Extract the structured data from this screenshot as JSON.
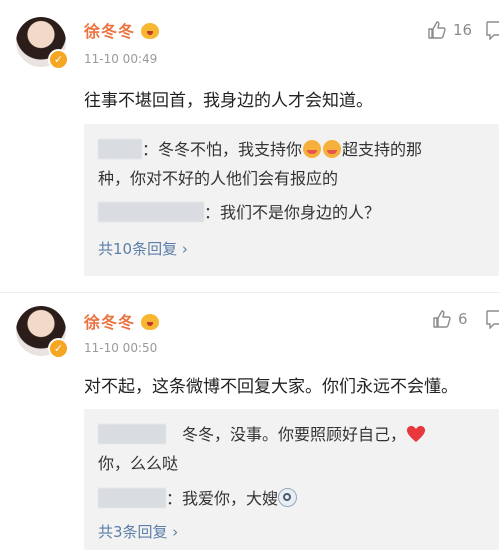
{
  "comments": [
    {
      "username": "徐冬冬",
      "timestamp": "11-10 00:49",
      "likes": "16",
      "content": "往事不堪回首，我身边的人才会知道。",
      "replies": [
        {
          "text_a": "：冬冬不怕，我支持你",
          "text_b": "超支持的那",
          "text_c": "种，你对不好的人他们会有报应的"
        },
        {
          "text_a": "：我们不是你身边的人？"
        }
      ],
      "expand_label": "共10条回复 ›"
    },
    {
      "username": "徐冬冬",
      "timestamp": "11-10 00:50",
      "likes": "6",
      "content": "对不起，这条微博不回复大家。你们永远不会懂。",
      "replies": [
        {
          "text_a": "冬冬，没事。你要照顾好自己，",
          "text_b": "你，么么哒"
        },
        {
          "text_a": "：我爱你，大嫂"
        }
      ],
      "expand_label": "共3条回复 ›"
    }
  ],
  "colors": {
    "username": "#eb7340",
    "link": "#5b7fa8",
    "reply_bg": "#f2f2f2",
    "heart": "#e8373d"
  },
  "icons": [
    "thumbs-up-icon",
    "comment-icon",
    "verified-badge-icon",
    "vip-badge-icon",
    "heart-icon"
  ]
}
